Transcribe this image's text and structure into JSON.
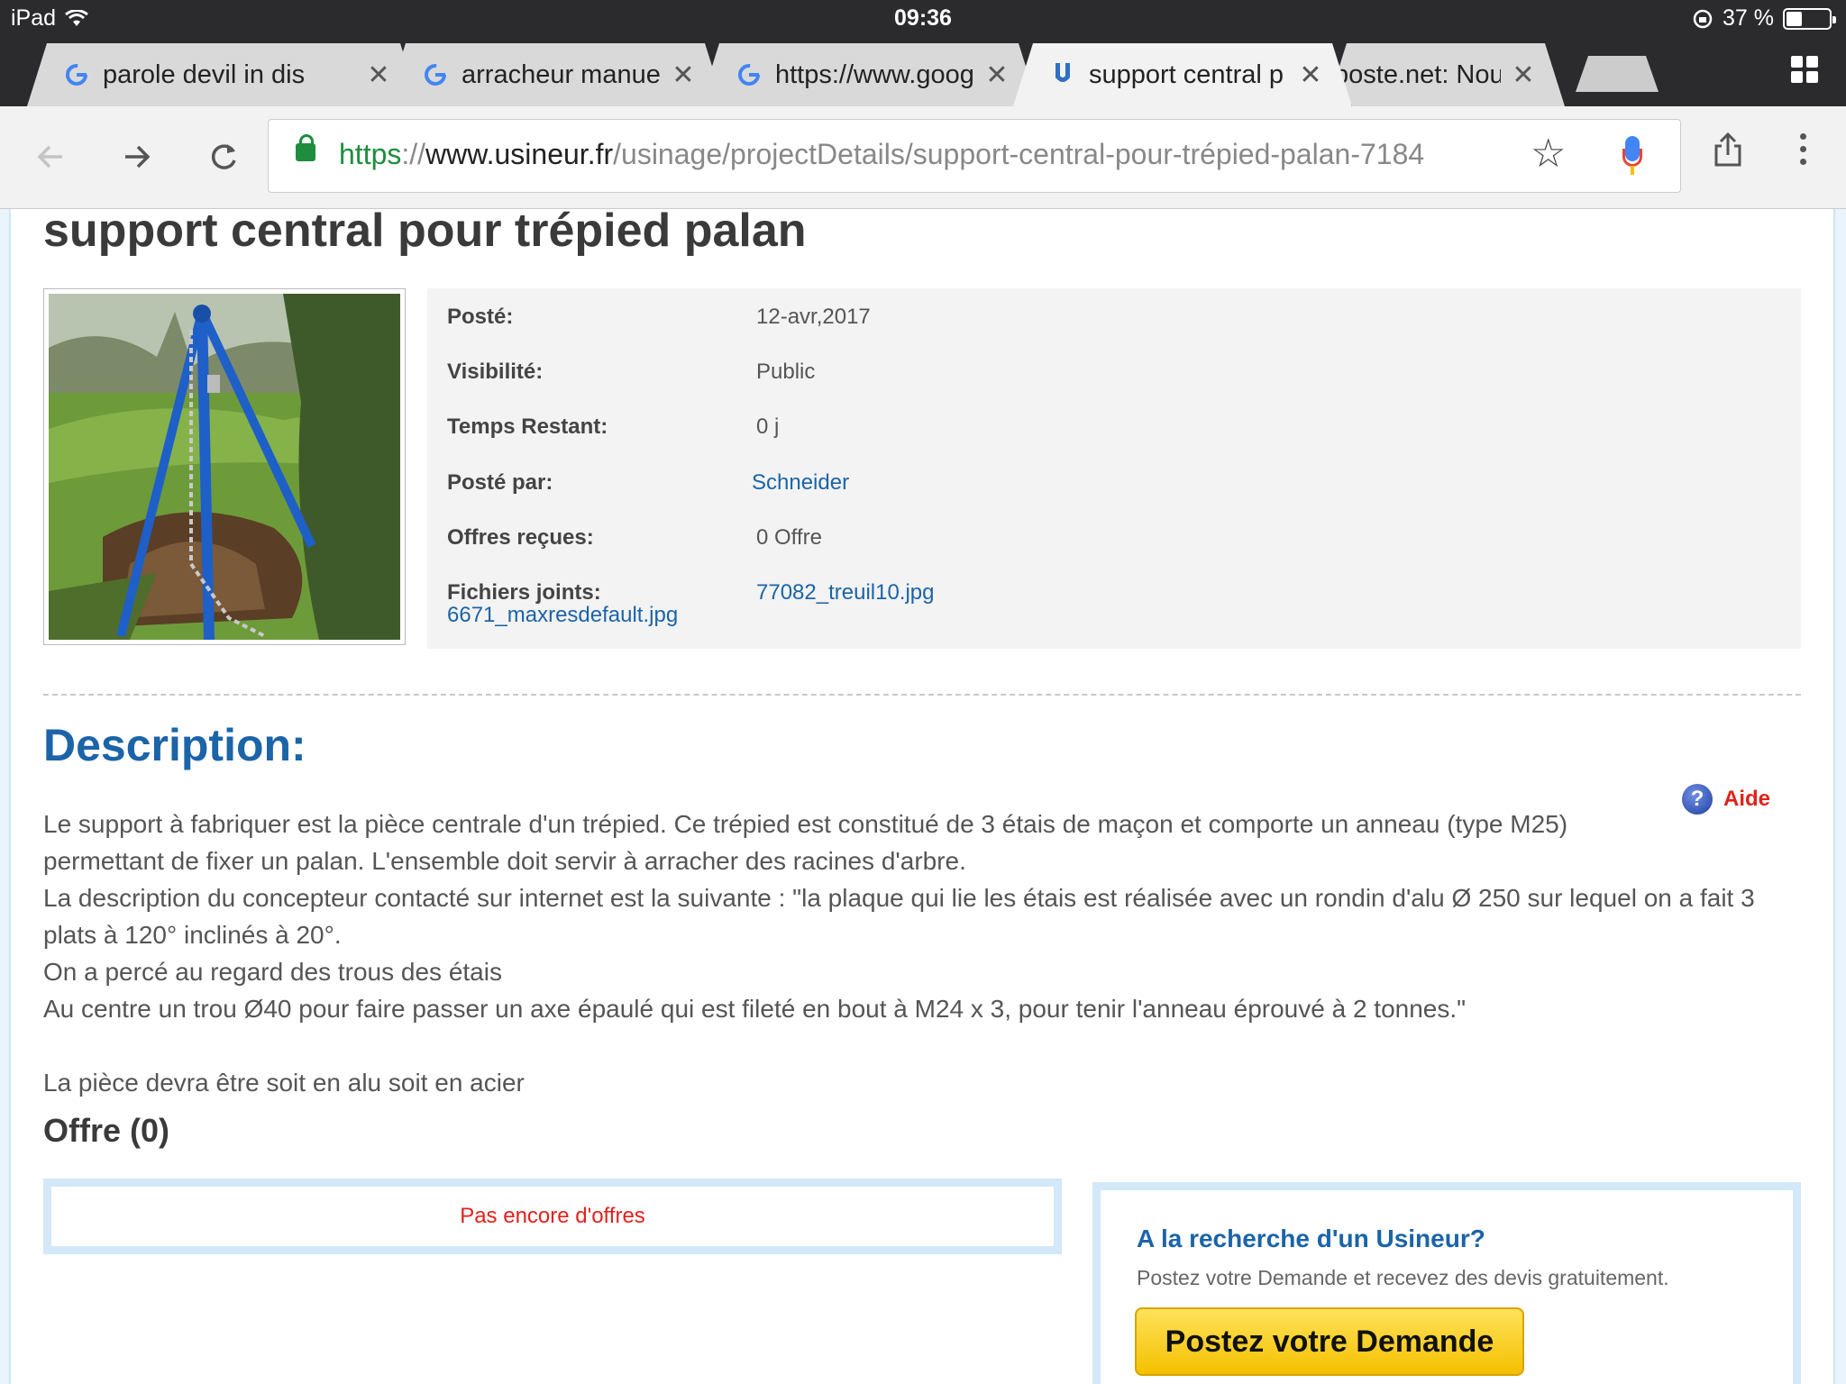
{
  "status_bar": {
    "device": "iPad",
    "time": "09:36",
    "battery": "37 %",
    "battery_level": 0.37
  },
  "tabs": [
    {
      "title": "parole devil in dis",
      "favicon": "google-icon",
      "active": false
    },
    {
      "title": "arracheur manuel",
      "favicon": "google-icon",
      "active": false
    },
    {
      "title": "https://www.goog",
      "favicon": "google-icon",
      "active": false
    },
    {
      "title": "support central p",
      "favicon": "usineur-icon",
      "active": true
    },
    {
      "title": "poste.net: Nouv",
      "favicon": "",
      "active": false
    }
  ],
  "toolbar": {
    "url_scheme": "https",
    "url_sep": "://",
    "url_host": "www.usineur.fr",
    "url_path": "/usinage/projectDetails/support-central-pour-trépied-palan-7184"
  },
  "page": {
    "title": "support central pour trépied palan",
    "details": {
      "posted_label": "Posté:",
      "posted_value": "12-avr,2017",
      "visibility_label": "Visibilité:",
      "visibility_value": "Public",
      "time_left_label": "Temps Restant:",
      "time_left_value": "0 j",
      "posted_by_label": "Posté par:",
      "posted_by_value": "Schneider",
      "offers_label": "Offres reçues:",
      "offers_value": "0 Offre",
      "files_label": "Fichiers joints:",
      "file_1": "77082_treuil10.jpg",
      "file_2": "6671_maxresdefault.jpg"
    },
    "description_heading": "Description:",
    "help_label": "Aide",
    "description_lines": [
      "Le support à fabriquer est la pièce centrale d'un trépied. Ce trépied est constitué de 3 étais de maçon et comporte un anneau (type M25)",
      "permettant de fixer un palan. L'ensemble doit servir à arracher des racines d'arbre.",
      "La description du concepteur contacté sur internet est la suivante : \"la plaque qui lie les étais est réalisée avec un rondin d'alu Ø 250 sur lequel on a fait 3",
      "plats à 120° inclinés à 20°.",
      "On a percé au regard des trous des étais",
      "Au centre un trou Ø40 pour faire passer un axe épaulé qui est fileté en bout à M24 x 3, pour tenir l'anneau éprouvé à 2 tonnes.\"",
      "",
      "La pièce devra être soit en alu soit en acier"
    ],
    "offers_heading": "Offre (0)",
    "no_offers": "Pas encore d'offres",
    "promo": {
      "title": "A la recherche d'un Usineur?",
      "subtitle": "Postez votre Demande et recevez des devis gratuitement.",
      "button": "Postez votre Demande"
    }
  },
  "colors": {
    "link": "#1b64a8",
    "alert_red": "#e3211c",
    "button_yellow": "#f4c000",
    "frame_blue": "#d3e8f8"
  }
}
